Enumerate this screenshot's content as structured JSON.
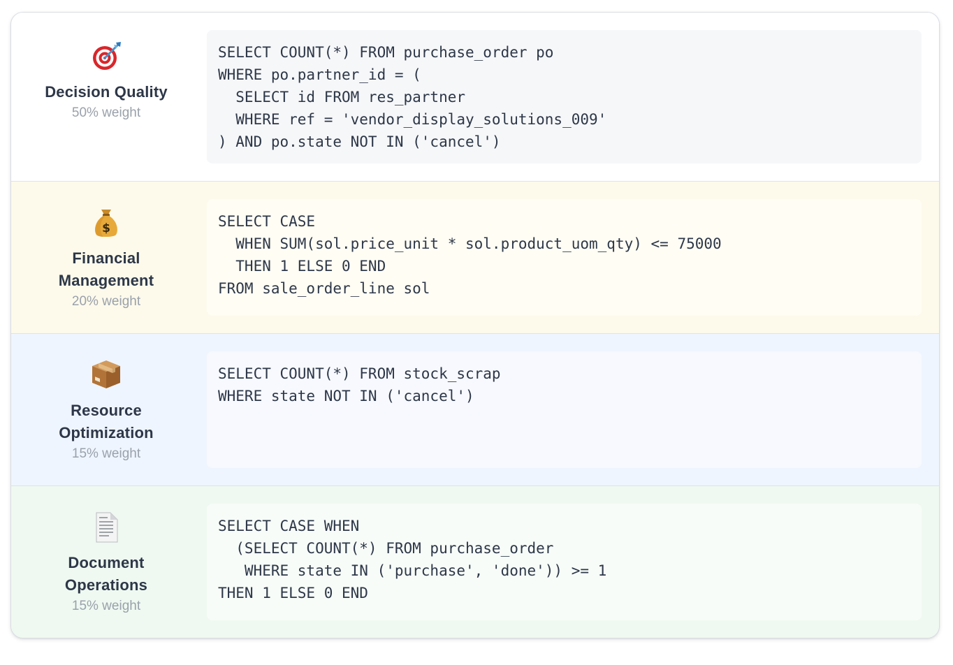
{
  "metrics": [
    {
      "name_lines": [
        "Decision Quality"
      ],
      "weight": "50% weight",
      "icon": "target-icon",
      "query_lines": [
        "SELECT COUNT(*) FROM purchase_order po",
        "WHERE po.partner_id = (",
        "  SELECT id FROM res_partner",
        "  WHERE ref = 'vendor_display_solutions_009'",
        ") AND po.state NOT IN ('cancel')"
      ],
      "row_bg": "#ffffff",
      "code_bg": "#f6f7f9"
    },
    {
      "name_lines": [
        "Financial",
        "Management"
      ],
      "weight": "20% weight",
      "icon": "money-bag-icon",
      "query_lines": [
        "SELECT CASE",
        "  WHEN SUM(sol.price_unit * sol.product_uom_qty) <= 75000",
        "  THEN 1 ELSE 0 END",
        "FROM sale_order_line sol"
      ],
      "row_bg": "#fdfaeb",
      "code_bg": "#fffdf4"
    },
    {
      "name_lines": [
        "Resource",
        "Optimization"
      ],
      "weight": "15% weight",
      "icon": "package-icon",
      "query_lines": [
        "SELECT COUNT(*) FROM stock_scrap",
        "WHERE state NOT IN ('cancel')"
      ],
      "row_bg": "#eff5fe",
      "code_bg": "#f7f9fe"
    },
    {
      "name_lines": [
        "Document",
        "Operations"
      ],
      "weight": "15% weight",
      "icon": "document-icon",
      "query_lines": [
        "SELECT CASE WHEN",
        "  (SELECT COUNT(*) FROM purchase_order",
        "   WHERE state IN ('purchase', 'done')) >= 1",
        "THEN 1 ELSE 0 END"
      ],
      "row_bg": "#eff9f1",
      "code_bg": "#f7fcf8"
    }
  ]
}
